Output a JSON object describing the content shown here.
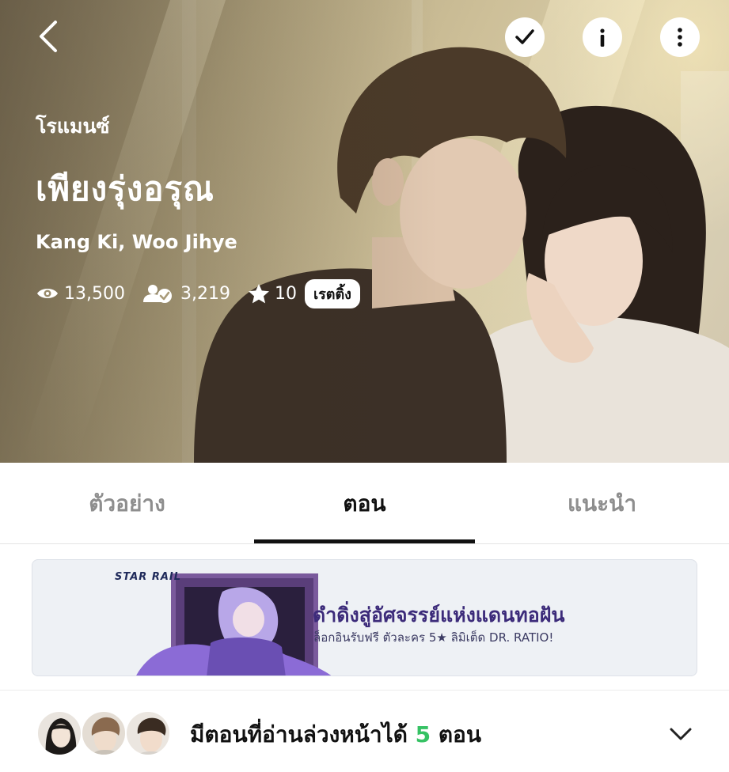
{
  "hero": {
    "genre": "โรแมนซ์",
    "title": "เพียงรุ่งอรุณ",
    "authors": "Kang Ki, Woo Jihye",
    "stats": {
      "views": "13,500",
      "subscribers": "3,219",
      "rating": "10",
      "rating_button": "เรตติ้ง"
    }
  },
  "top_bar": {
    "icons": [
      "back-arrow-icon",
      "checkmark-icon",
      "info-icon",
      "more-vertical-icon"
    ]
  },
  "tabs": [
    {
      "label": "ตัวอย่าง",
      "active": false
    },
    {
      "label": "ตอน",
      "active": true
    },
    {
      "label": "แนะนำ",
      "active": false
    }
  ],
  "banner": {
    "logo": "STAR RAIL",
    "headline": "ดำดิ่งสู่อัศจรรย์แห่งแดนทอฝัน",
    "subtext": "ล็อกอินรับฟรี ตัวละคร 5★ ลิมิเต็ด DR. RATIO!"
  },
  "early_access": {
    "prefix": "มีตอนที่อ่านล่วงหน้าได้",
    "count": "5",
    "suffix": "ตอน"
  },
  "colors": {
    "accent_green": "#36c264",
    "banner_headline": "#3c2b7a",
    "tab_active": "#111111",
    "tab_inactive": "#8e8e8e"
  }
}
